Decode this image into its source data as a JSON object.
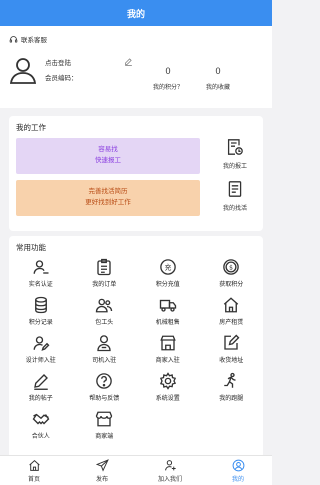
{
  "header": {
    "title": "我的"
  },
  "profile": {
    "customer_service": "联系客服",
    "login_label": "点击登陆",
    "member_label": "会员编码：",
    "points_value": "0",
    "points_label": "我的积分？",
    "favorites_value": "0",
    "favorites_label": "我的收藏"
  },
  "work": {
    "title": "我的工作",
    "banner1": {
      "line1": "容易找",
      "line2": "快速报工"
    },
    "banner2": {
      "line1": "完善找活简历",
      "line2": "更好找到好工作"
    },
    "items": [
      "我的报工",
      "我的找活"
    ]
  },
  "functions": {
    "title": "常用功能",
    "items": [
      {
        "label": "实名认证",
        "icon": "user-verify-icon"
      },
      {
        "label": "我的订单",
        "icon": "clipboard-icon"
      },
      {
        "label": "积分充值",
        "icon": "recharge-icon"
      },
      {
        "label": "获取积分",
        "icon": "coin-icon"
      },
      {
        "label": "积分记录",
        "icon": "database-icon"
      },
      {
        "label": "包工头",
        "icon": "users-icon"
      },
      {
        "label": "机械租售",
        "icon": "truck-icon"
      },
      {
        "label": "房产租赁",
        "icon": "house-icon"
      },
      {
        "label": "设计师入驻",
        "icon": "user-edit-icon"
      },
      {
        "label": "司机入驻",
        "icon": "driver-icon"
      },
      {
        "label": "商家入驻",
        "icon": "shop-icon"
      },
      {
        "label": "收货地址",
        "icon": "edit-square-icon"
      },
      {
        "label": "我的帖子",
        "icon": "pen-icon"
      },
      {
        "label": "帮助与反馈",
        "icon": "help-icon"
      },
      {
        "label": "系统设置",
        "icon": "gear-icon"
      },
      {
        "label": "我的跑腿",
        "icon": "runner-icon"
      },
      {
        "label": "合伙人",
        "icon": "handshake-icon"
      },
      {
        "label": "商家端",
        "icon": "store-icon"
      }
    ]
  },
  "tabbar": {
    "items": [
      {
        "label": "首页",
        "icon": "home-icon"
      },
      {
        "label": "发布",
        "icon": "send-icon"
      },
      {
        "label": "加入我们",
        "icon": "add-user-icon"
      },
      {
        "label": "我的",
        "icon": "profile-icon"
      }
    ]
  },
  "colors": {
    "accent": "#3a8ef0",
    "banner1_bg": "#e4d6f5",
    "banner2_bg": "#f8d2ac"
  }
}
